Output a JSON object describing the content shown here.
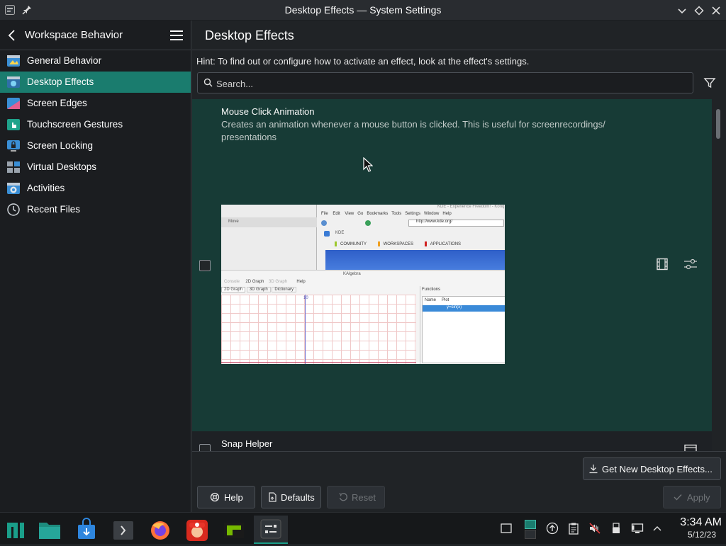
{
  "window": {
    "title": "Desktop Effects — System Settings"
  },
  "sidebar": {
    "header": "Workspace Behavior",
    "items": [
      {
        "label": "General Behavior",
        "icon": "general-behavior-icon",
        "selected": false
      },
      {
        "label": "Desktop Effects",
        "icon": "desktop-effects-icon",
        "selected": true
      },
      {
        "label": "Screen Edges",
        "icon": "screen-edges-icon",
        "selected": false
      },
      {
        "label": "Touchscreen Gestures",
        "icon": "touchscreen-gestures-icon",
        "selected": false
      },
      {
        "label": "Screen Locking",
        "icon": "screen-locking-icon",
        "selected": false
      },
      {
        "label": "Virtual Desktops",
        "icon": "virtual-desktops-icon",
        "selected": false
      },
      {
        "label": "Activities",
        "icon": "activities-icon",
        "selected": false
      },
      {
        "label": "Recent Files",
        "icon": "recent-files-icon",
        "selected": false
      }
    ]
  },
  "main": {
    "title": "Desktop Effects",
    "hint": "Hint: To find out or configure how to activate an effect, look at the effect's settings.",
    "search_placeholder": "Search...",
    "effects": [
      {
        "name": "Mouse Click Animation",
        "description_line1": "Creates an animation whenever a mouse button is clicked. This is useful for screenrecordings/",
        "description_line2": "presentations",
        "enabled": false
      },
      {
        "name": "Snap Helper",
        "enabled": false
      }
    ],
    "preview": {
      "window_label_left": "Move",
      "browser_title": "KDE - Experience Freedom! - Konq",
      "browser_menu": [
        "File",
        "Edit",
        "View",
        "Go",
        "Bookmarks",
        "Tools",
        "Settings",
        "Window",
        "Help"
      ],
      "url": "http://www.kde.org/",
      "tab_label": "KDE",
      "nav": [
        "COMMUNITY",
        "WORKSPACES",
        "APPLICATIONS"
      ],
      "kalgebra_title": "KAlgebra",
      "kalgebra_menu": [
        "Console",
        "2D Graph",
        "3D Graph",
        "Help"
      ],
      "kalgebra_tabs": [
        "2D Graph",
        "3D Graph",
        "Dictionary"
      ],
      "functions_label": "Functions",
      "col_name": "Name",
      "col_plot": "Plot",
      "plot_value": "y=sin(x)",
      "axis_label": "10"
    },
    "buttons": {
      "get_new": "Get New Desktop Effects...",
      "help": "Help",
      "defaults": "Defaults",
      "reset": "Reset",
      "apply": "Apply"
    }
  },
  "taskbar": {
    "apps": [
      "application-launcher-icon",
      "file-manager-icon",
      "discover-store-icon",
      "terminal-icon",
      "firefox-icon",
      "mario-game-icon",
      "nvidia-geforce-icon",
      "system-settings-icon"
    ],
    "clock_time": "3:34 AM",
    "clock_date": "5/12/23"
  },
  "colors": {
    "accent": "#1a7c6e",
    "card_bg": "#173b36",
    "window_bg": "#202326"
  }
}
